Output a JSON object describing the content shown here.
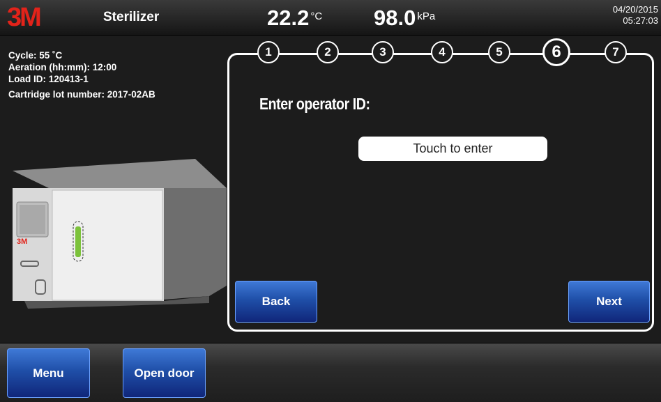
{
  "header": {
    "brand": "3M",
    "title": "Sterilizer",
    "temperature": {
      "value": "22.2",
      "unit": "°C"
    },
    "pressure": {
      "value": "98.0",
      "unit": "kPa"
    },
    "date": "04/20/2015",
    "time": "05:27:03"
  },
  "info": {
    "cycle": "Cycle: 55 ˚C",
    "aeration": "Aeration (hh:mm): 12:00",
    "load_id": "Load ID: 120413-1",
    "cartridge": "Cartridge lot number: 2017-02AB"
  },
  "machine": {
    "brand": "3M"
  },
  "wizard": {
    "steps": [
      "1",
      "2",
      "3",
      "4",
      "5",
      "6",
      "7"
    ],
    "active_step": 6,
    "prompt": "Enter operator ID:",
    "entry_placeholder": "Touch to enter",
    "back_label": "Back",
    "next_label": "Next"
  },
  "footer": {
    "menu_label": "Menu",
    "open_door_label": "Open door"
  },
  "colors": {
    "brand_red": "#e2231a",
    "button_blue": "#1f4fa8",
    "indicator_green": "#7cc23b"
  }
}
